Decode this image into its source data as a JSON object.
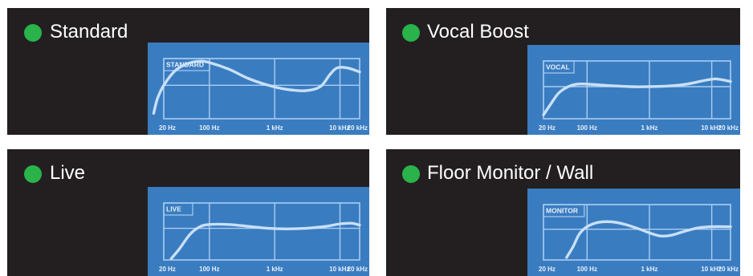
{
  "presets": [
    {
      "id": "standard",
      "name": "Standard",
      "graph_label": "STANDARD",
      "active": true,
      "indicator_color": "#29b34a",
      "curve": [
        [
          14,
          -2.1
        ],
        [
          16,
          -1.0
        ],
        [
          20,
          0.0
        ],
        [
          30,
          1.1
        ],
        [
          45,
          1.6
        ],
        [
          70,
          1.8
        ],
        [
          100,
          1.7
        ],
        [
          200,
          1.2
        ],
        [
          400,
          0.5
        ],
        [
          800,
          0.0
        ],
        [
          1500,
          -0.3
        ],
        [
          3000,
          -0.4
        ],
        [
          5000,
          -0.1
        ],
        [
          7000,
          0.8
        ],
        [
          9000,
          1.3
        ],
        [
          13000,
          1.3
        ],
        [
          20000,
          1.0
        ]
      ]
    },
    {
      "id": "vocal",
      "name": "Vocal Boost",
      "graph_label": "VOCAL",
      "active": true,
      "indicator_color": "#29b34a",
      "curve": [
        [
          20,
          -2.2
        ],
        [
          25,
          -1.5
        ],
        [
          35,
          -0.5
        ],
        [
          50,
          0.0
        ],
        [
          70,
          0.2
        ],
        [
          100,
          0.2
        ],
        [
          200,
          0.1
        ],
        [
          500,
          0.0
        ],
        [
          1000,
          0.0
        ],
        [
          2000,
          0.05
        ],
        [
          4000,
          0.2
        ],
        [
          8000,
          0.5
        ],
        [
          12000,
          0.6
        ],
        [
          20000,
          0.4
        ]
      ]
    },
    {
      "id": "live",
      "name": "Live",
      "graph_label": "LIVE",
      "active": true,
      "indicator_color": "#29b34a",
      "curve": [
        [
          26,
          -2.4
        ],
        [
          35,
          -1.6
        ],
        [
          50,
          -0.5
        ],
        [
          70,
          0.1
        ],
        [
          100,
          0.3
        ],
        [
          200,
          0.3
        ],
        [
          400,
          0.15
        ],
        [
          800,
          0.0
        ],
        [
          1500,
          -0.05
        ],
        [
          3000,
          0.0
        ],
        [
          6000,
          0.15
        ],
        [
          10000,
          0.35
        ],
        [
          15000,
          0.4
        ],
        [
          20000,
          0.25
        ]
      ]
    },
    {
      "id": "monitor",
      "name": "Floor Monitor / Wall",
      "graph_label": "MONITOR",
      "active": true,
      "indicator_color": "#29b34a",
      "curve": [
        [
          47,
          -2.3
        ],
        [
          60,
          -1.4
        ],
        [
          75,
          -0.4
        ],
        [
          100,
          0.2
        ],
        [
          150,
          0.55
        ],
        [
          250,
          0.6
        ],
        [
          400,
          0.4
        ],
        [
          700,
          0.0
        ],
        [
          1000,
          -0.3
        ],
        [
          1500,
          -0.55
        ],
        [
          2200,
          -0.5
        ],
        [
          3500,
          -0.2
        ],
        [
          6000,
          0.1
        ],
        [
          10000,
          0.2
        ],
        [
          20000,
          0.2
        ]
      ]
    }
  ],
  "freq_axis": {
    "ticks": [
      {
        "value": 20,
        "label": "20 Hz"
      },
      {
        "value": 100,
        "label": "100 Hz"
      },
      {
        "value": 1000,
        "label": "1 kHz"
      },
      {
        "value": 10000,
        "label": "10 kHz"
      },
      {
        "value": 20000,
        "label": "20 kHz"
      }
    ],
    "range": [
      20,
      20000
    ],
    "scale": "log"
  },
  "level_axis": {
    "range": [
      -2.5,
      2.0
    ],
    "reference_line": 0,
    "unit": ""
  },
  "colors": {
    "panel_bg": "#231f20",
    "graph_bg": "#3a7cc0",
    "grid": "#a9cdf2",
    "curve": "#c8e0f7",
    "text": "#ffffff"
  }
}
